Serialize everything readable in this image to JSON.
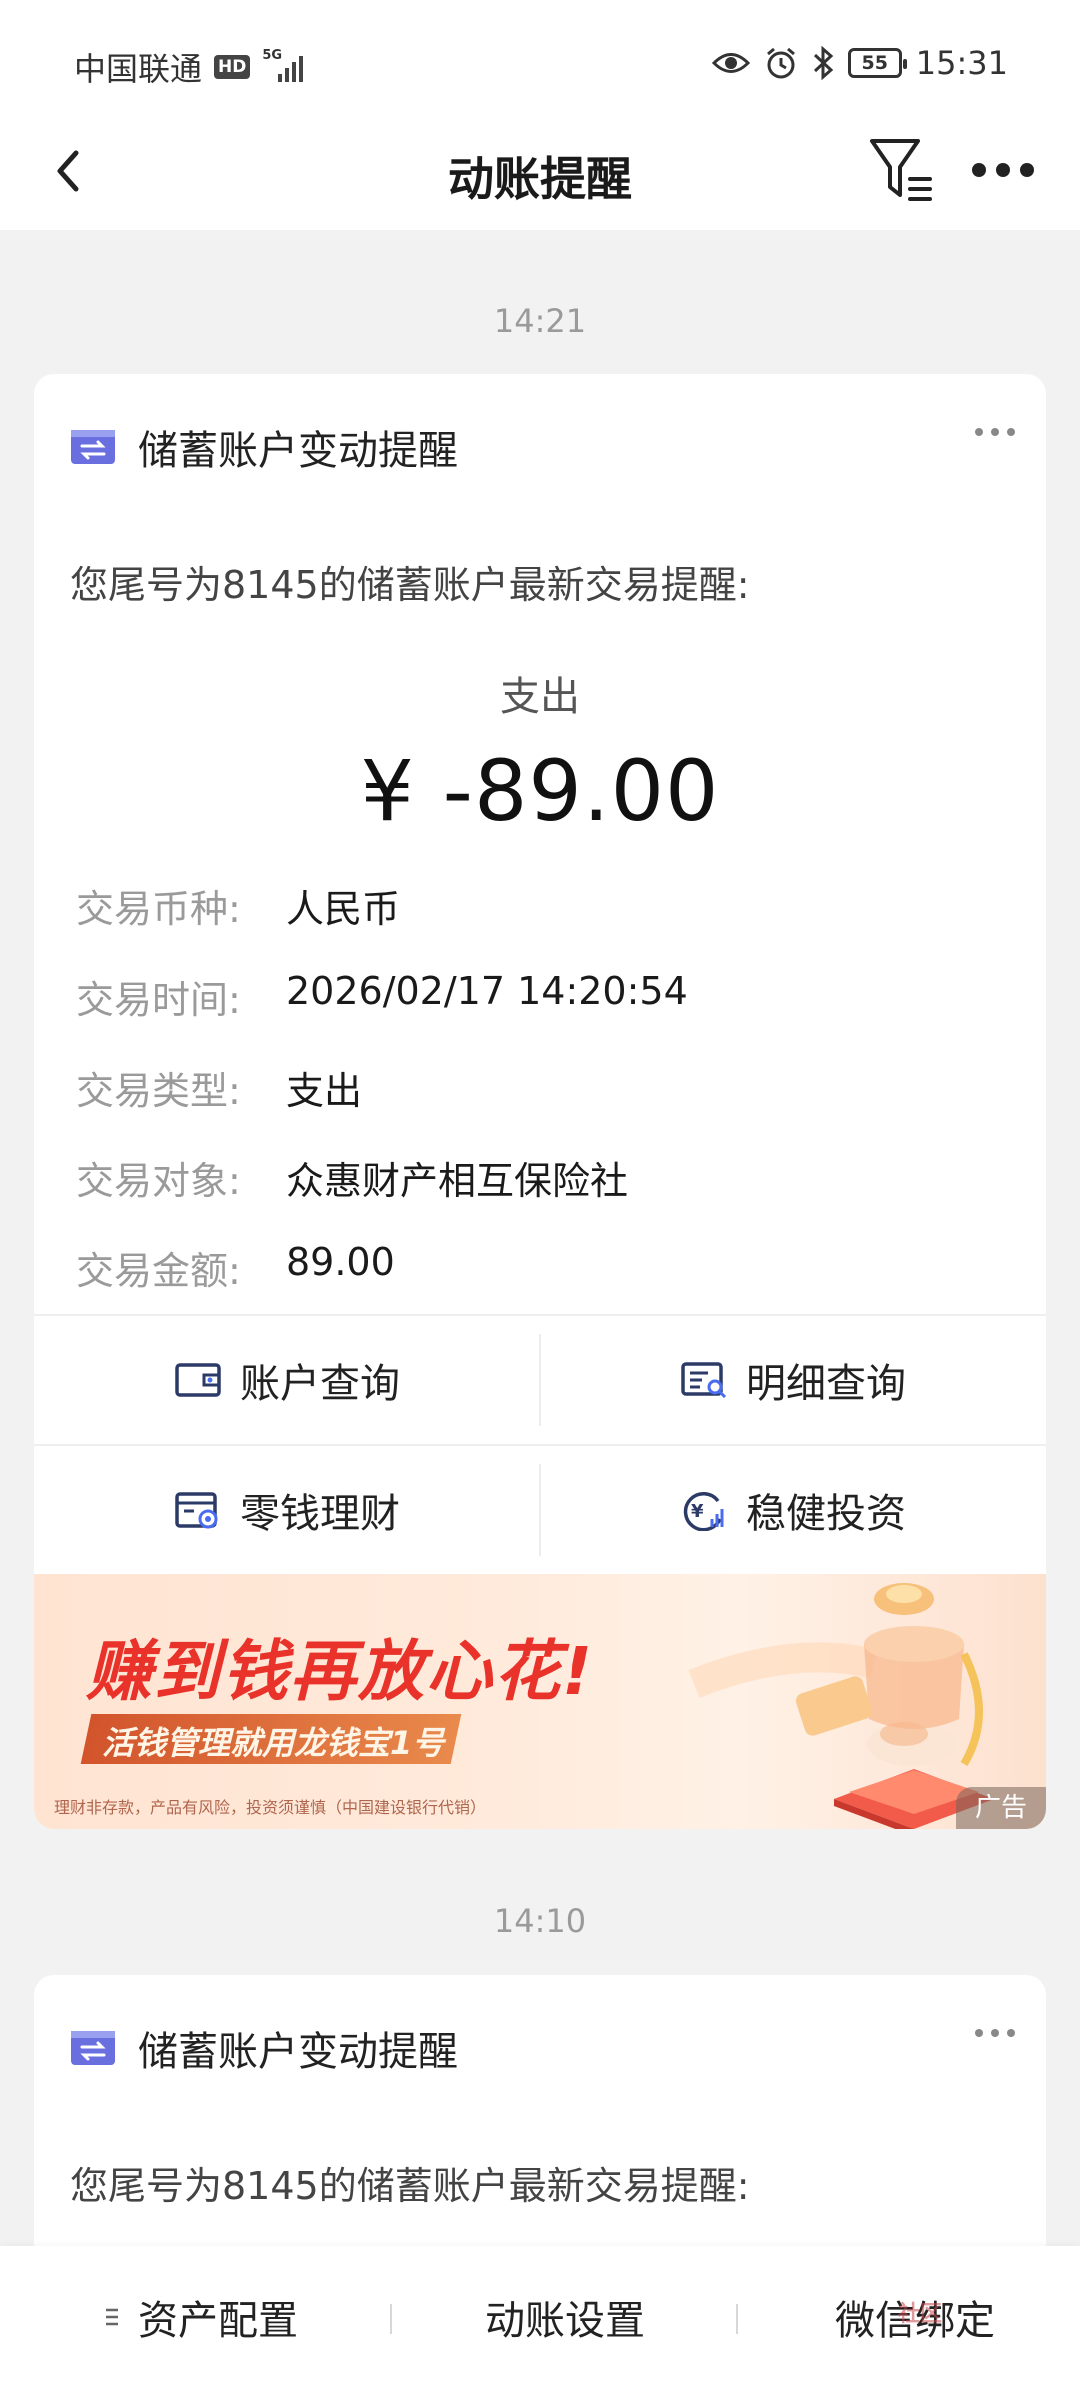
{
  "status_bar": {
    "carrier": "中国联通",
    "hd_badge": "HD",
    "network": "5G",
    "battery": "55",
    "time": "15:31",
    "icons": [
      "eye-icon",
      "alarm-icon",
      "bluetooth-icon",
      "battery-icon"
    ]
  },
  "nav": {
    "title": "动账提醒",
    "icons": [
      "back-chevron-icon",
      "filter-icon",
      "more-dots-icon"
    ]
  },
  "messages": [
    {
      "time": "14:21",
      "card_title": "储蓄账户变动提醒",
      "intro": "您尾号为8145的储蓄账户最新交易提醒:",
      "direction_label": "支出",
      "amount": "¥ -89.00",
      "fields": [
        {
          "key": "交易币种:",
          "value": "人民币"
        },
        {
          "key": "交易时间:",
          "value": "2026/02/17 14:20:54"
        },
        {
          "key": "交易类型:",
          "value": "支出"
        },
        {
          "key": "交易对象:",
          "value": "众惠财产相互保险社"
        },
        {
          "key": "交易金额:",
          "value": "89.00"
        }
      ],
      "actions": [
        {
          "label": "账户查询",
          "icon": "wallet-icon"
        },
        {
          "label": "明细查询",
          "icon": "detail-search-icon"
        },
        {
          "label": "零钱理财",
          "icon": "wealth-icon"
        },
        {
          "label": "稳健投资",
          "icon": "investment-icon"
        }
      ],
      "banner": {
        "headline": "赚到钱再放心花!",
        "subline": "活钱管理就用龙钱宝1号",
        "disclaimer": "理财非存款，产品有风险，投资须谨慎（中国建设银行代销）",
        "tag": "广告"
      }
    },
    {
      "time": "14:10",
      "card_title": "储蓄账户变动提醒",
      "intro": "您尾号为8145的储蓄账户最新交易提醒:"
    }
  ],
  "bottom_bar": {
    "items": [
      "资产配置",
      "动账设置",
      "微信绑定"
    ]
  },
  "watermark": "社区",
  "colors": {
    "accent_purple": "#6a6fe0",
    "icon_navy": "#2b3a67",
    "banner_red": "#e8322a"
  }
}
